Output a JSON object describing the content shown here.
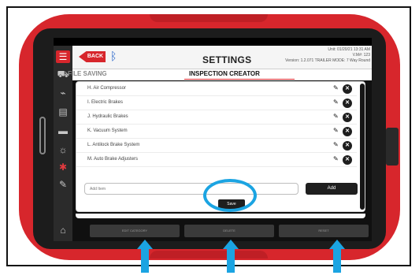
{
  "colors": {
    "case_red": "#d7262c",
    "highlight_blue": "#1ba4e2",
    "bluetooth_blue": "#2463c9"
  },
  "status_bar": {
    "left": "",
    "right": ""
  },
  "rail": {
    "items": [
      {
        "icon": "menu-icon"
      },
      {
        "icon": "truck-icon"
      },
      {
        "icon": "pulse-icon"
      },
      {
        "icon": "clipboard-icon"
      },
      {
        "icon": "folder-icon"
      },
      {
        "icon": "bulb-icon"
      },
      {
        "icon": "gear-icon"
      },
      {
        "icon": "edit-icon"
      },
      {
        "icon": "remote-icon"
      }
    ]
  },
  "header": {
    "back_label": "BACK",
    "title": "SETTINGS",
    "meta_line1": "Unit: 01/20/21 13:31 AM",
    "meta_line2": "V.M#: 123",
    "meta_line3": "Version: 1.2.071 TRAILER MODE: 7 Way Round"
  },
  "tabs": {
    "file_saving": "FILE SAVING",
    "inspection_creator": "INSPECTION CREATOR"
  },
  "inspection_items": [
    {
      "label": "H. Air Compressor"
    },
    {
      "label": "I. Electric Brakes"
    },
    {
      "label": "J. Hydraulic Brakes"
    },
    {
      "label": "K. Vacuum System"
    },
    {
      "label": "L. Antilock Brake System"
    },
    {
      "label": "M. Auto Brake Adjusters"
    }
  ],
  "add_item": {
    "placeholder": "Add Item",
    "add_label": "Add"
  },
  "save_label": "Save",
  "bottom_tabs": [
    "EDIT CATEGORY",
    "DELETE",
    "RESET"
  ]
}
